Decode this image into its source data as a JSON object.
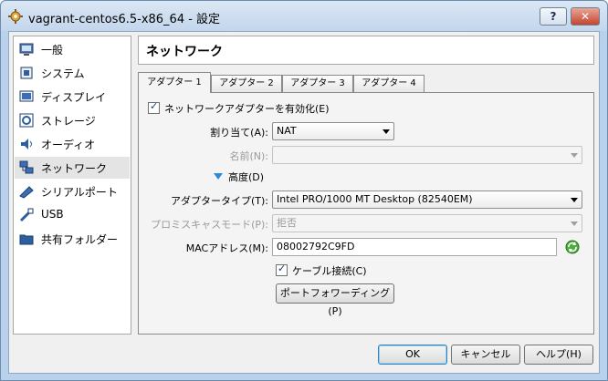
{
  "window": {
    "title": "vagrant-centos6.5-x86_64 - 設定",
    "help_label": "?",
    "close_label": "✕"
  },
  "sidebar": {
    "items": [
      {
        "label": "一般",
        "icon": "monitor-icon"
      },
      {
        "label": "システム",
        "icon": "chip-icon"
      },
      {
        "label": "ディスプレイ",
        "icon": "display-icon"
      },
      {
        "label": "ストレージ",
        "icon": "storage-icon"
      },
      {
        "label": "オーディオ",
        "icon": "speaker-icon"
      },
      {
        "label": "ネットワーク",
        "icon": "network-icon"
      },
      {
        "label": "シリアルポート",
        "icon": "serial-port-icon"
      },
      {
        "label": "USB",
        "icon": "usb-icon"
      },
      {
        "label": "共有フォルダー",
        "icon": "folder-icon"
      }
    ],
    "selected": "ネットワーク"
  },
  "header": {
    "title": "ネットワーク"
  },
  "tabs": [
    "アダプター 1",
    "アダプター 2",
    "アダプター 3",
    "アダプター 4"
  ],
  "form": {
    "enable_label": "ネットワークアダプターを有効化(E)",
    "attached_label": "割り当て(A):",
    "attached_value": "NAT",
    "name_label": "名前(N):",
    "name_value": "",
    "advanced_label": "高度(D)",
    "adapter_type_label": "アダプタータイプ(T):",
    "adapter_type_value": "Intel PRO/1000 MT Desktop (82540EM)",
    "promisc_label": "プロミスキャスモード(P):",
    "promisc_value": "拒否",
    "mac_label": "MACアドレス(M):",
    "mac_value": "08002792C9FD",
    "cable_label": "ケーブル接続(C)",
    "port_forward_label": "ポートフォワーディング(P)"
  },
  "buttons": {
    "ok": "OK",
    "cancel": "キャンセル",
    "help": "ヘルプ(H)"
  },
  "colors": {
    "accent": "#2c88d9",
    "title_bar": "#c3d6ec",
    "close": "#c4452d"
  }
}
